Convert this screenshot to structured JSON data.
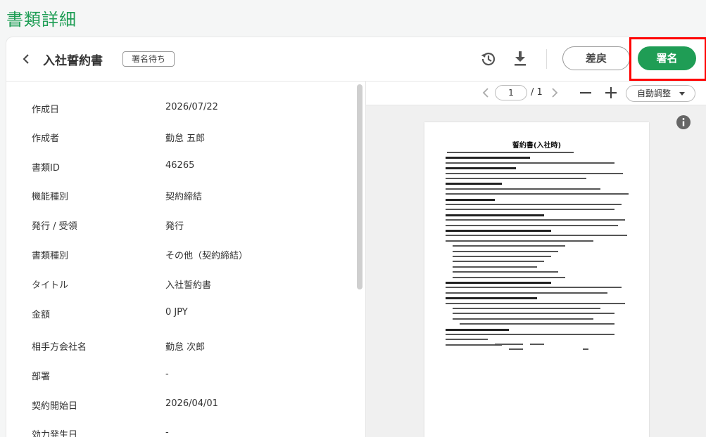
{
  "page": {
    "title": "書類詳細"
  },
  "header": {
    "doc_title": "入社誓約書",
    "status": "署名待ち",
    "return_label": "差戻",
    "sign_label": "署名"
  },
  "fields": [
    {
      "label": "作成日",
      "value": "2026/07/22"
    },
    {
      "label": "作成者",
      "value": "勤怠 五郎"
    },
    {
      "label": "書類ID",
      "value": "46265"
    },
    {
      "label": "機能種別",
      "value": "契約締結"
    },
    {
      "label": "発行 / 受領",
      "value": "発行"
    },
    {
      "label": "書類種別",
      "value": "その他（契約締結）"
    },
    {
      "label": "タイトル",
      "value": "入社誓約書"
    },
    {
      "label": "金額",
      "value": "0 JPY"
    },
    {
      "label": "相手方会社名",
      "value": "勤怠 次郎"
    },
    {
      "label": "部署",
      "value": "-"
    },
    {
      "label": "契約開始日",
      "value": "2026/04/01"
    },
    {
      "label": "効力発生日",
      "value": "-"
    }
  ],
  "viewer": {
    "current_page": "1",
    "total_pages": "/ 1",
    "zoom": "自動調整",
    "doc_heading": "誓約書(入社時)"
  },
  "colors": {
    "accent": "#1f9d55",
    "highlight": "#ff0000"
  }
}
